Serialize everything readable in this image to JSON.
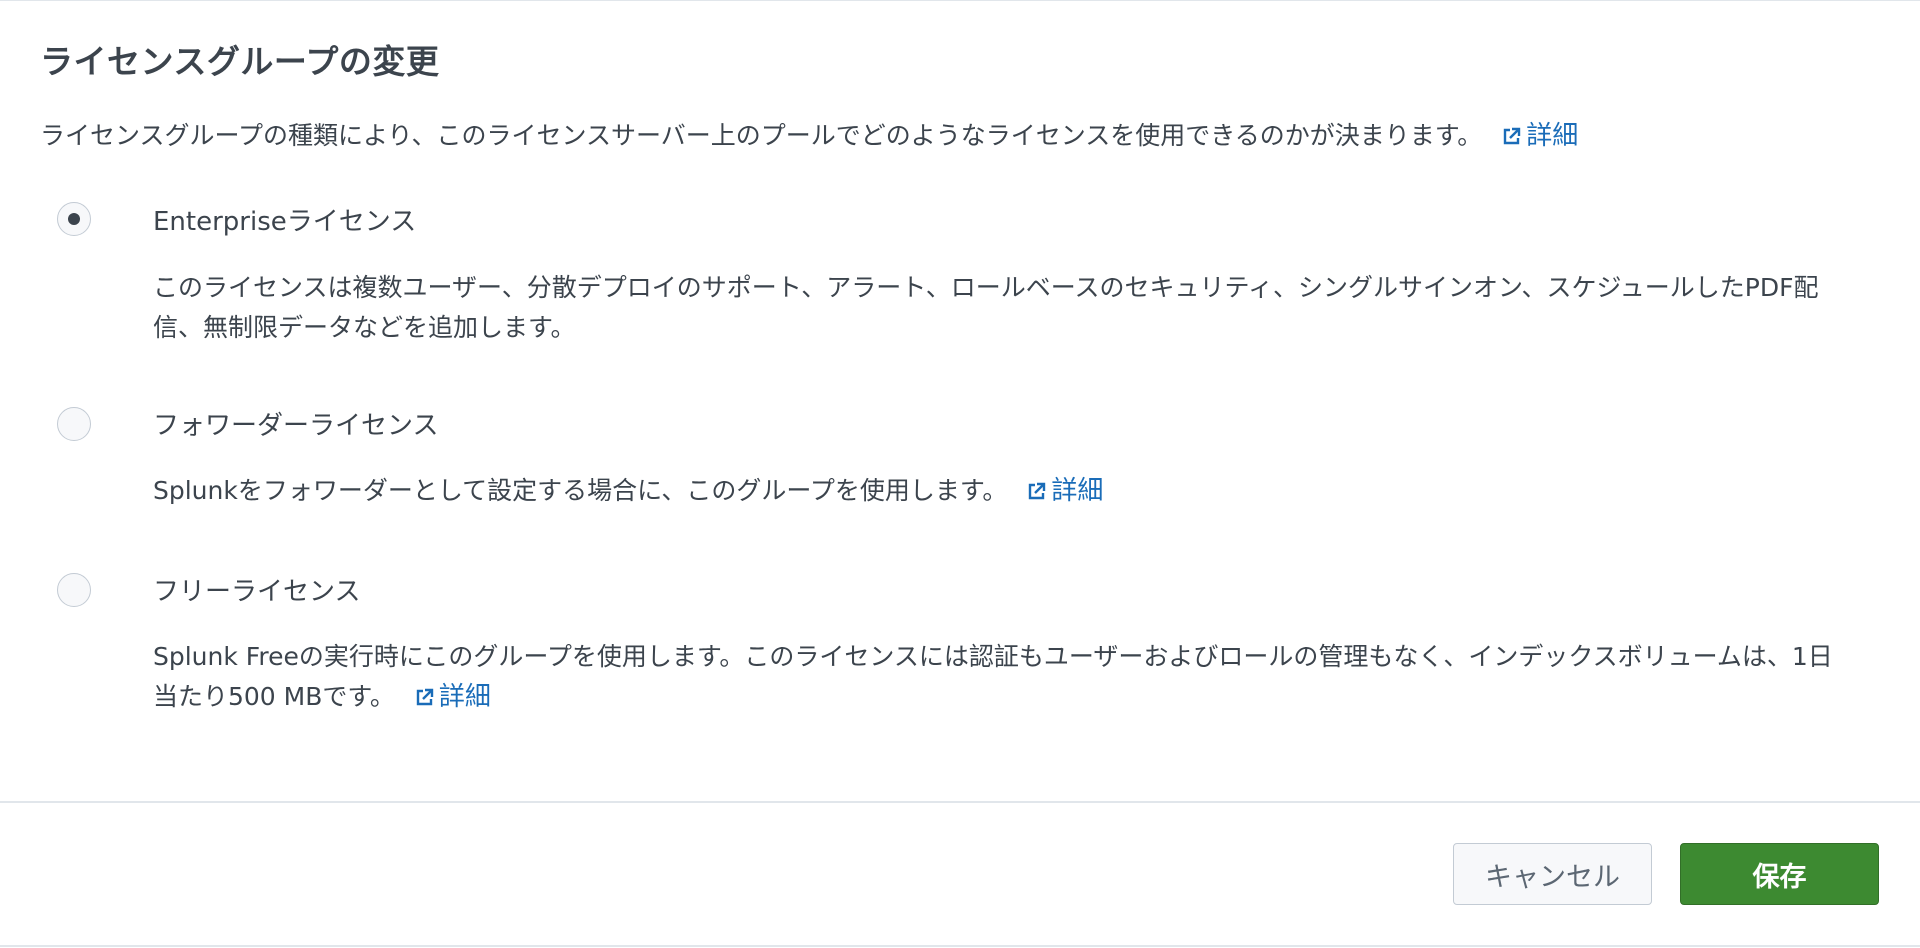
{
  "dialog": {
    "title": "ライセンスグループの変更",
    "intro_text": "ライセンスグループの種類により、このライセンスサーバー上のプールでどのようなライセンスを使用できるのかが決まります。",
    "learn_more_label": "詳細"
  },
  "options": [
    {
      "label": "Enterpriseライセンス",
      "selected": true,
      "description": "このライセンスは複数ユーザー、分散デプロイのサポート、アラート、ロールベースのセキュリティ、シングルサインオン、スケジュールしたPDF配信、無制限データなどを追加します。",
      "learn_more_label": ""
    },
    {
      "label": "フォワーダーライセンス",
      "selected": false,
      "description": "Splunkをフォワーダーとして設定する場合に、このグループを使用します。",
      "learn_more_label": "詳細"
    },
    {
      "label": "フリーライセンス",
      "selected": false,
      "description": "Splunk Freeの実行時にこのグループを使用します。このライセンスには認証もユーザーおよびロールの管理もなく、インデックスボリュームは、1日当たり500 MBです。",
      "learn_more_label": "詳細"
    }
  ],
  "footer": {
    "cancel_label": "キャンセル",
    "save_label": "保存"
  },
  "colors": {
    "text": "#3c444d",
    "link": "#1a6cb8",
    "save_button": "#3d8a31",
    "divider": "#e1e6eb"
  },
  "icons": {
    "external_link": "external-link-icon"
  }
}
